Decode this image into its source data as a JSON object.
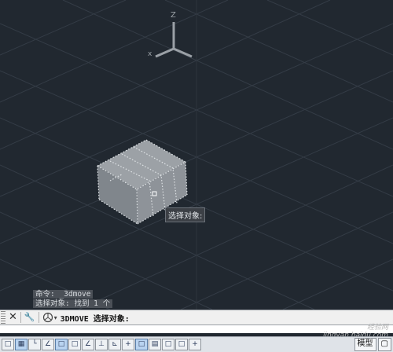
{
  "ucs": {
    "z_label": "Z"
  },
  "selection_tooltip": "选择对象:",
  "command_history": [
    "命令: _3dmove",
    "选择对象: 找到 1 个"
  ],
  "command_line": {
    "close_symbol": "✕",
    "customize_symbol": "🔧",
    "prompt": "3DMOVE 选择对象:"
  },
  "statusbar": {
    "buttons": [
      "□",
      "▦",
      "└",
      "∠",
      "□",
      "□",
      "∠",
      "⊥",
      "⊾",
      "+",
      "□",
      "▤",
      "□",
      "□",
      "+"
    ],
    "model_tab": "模型",
    "layout_tab": "▢"
  },
  "watermark": {
    "line1": "经验网",
    "line2": "jingyan.baidu.com"
  },
  "colors": {
    "canvas": "#212830",
    "grid": "#343c46",
    "cube": "#8c9196",
    "selection_dots": "#dfe3e6"
  }
}
